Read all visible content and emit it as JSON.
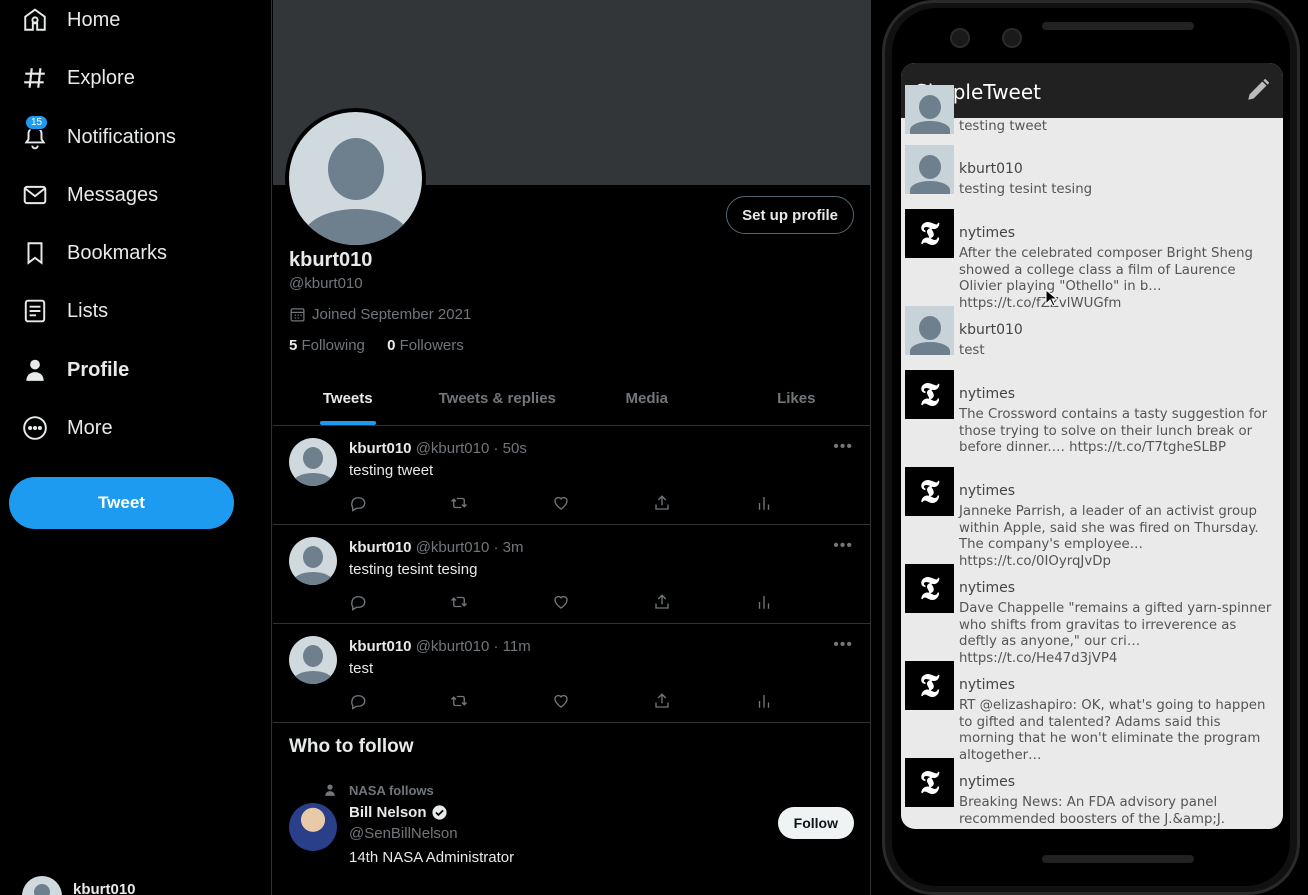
{
  "nav": {
    "items": [
      {
        "label": "Home",
        "icon": "home-icon"
      },
      {
        "label": "Explore",
        "icon": "hashtag-icon"
      },
      {
        "label": "Notifications",
        "icon": "bell-icon",
        "badge": "15"
      },
      {
        "label": "Messages",
        "icon": "envelope-icon"
      },
      {
        "label": "Bookmarks",
        "icon": "bookmark-icon"
      },
      {
        "label": "Lists",
        "icon": "list-icon"
      },
      {
        "label": "Profile",
        "icon": "person-icon"
      },
      {
        "label": "More",
        "icon": "more-circle-icon"
      }
    ],
    "tweet_button": "Tweet",
    "account_name": "kburt010"
  },
  "profile": {
    "setup_button": "Set up profile",
    "name": "kburt010",
    "handle": "@kburt010",
    "joined": "Joined September 2021",
    "following_count": "5",
    "following_label": "Following",
    "followers_count": "0",
    "followers_label": "Followers",
    "tabs": [
      "Tweets",
      "Tweets & replies",
      "Media",
      "Likes"
    ]
  },
  "tweets": [
    {
      "name": "kburt010",
      "meta": "@kburt010 · 50s",
      "text": "testing tweet"
    },
    {
      "name": "kburt010",
      "meta": "@kburt010 · 3m",
      "text": "testing tesint tesing"
    },
    {
      "name": "kburt010",
      "meta": "@kburt010 · 11m",
      "text": "test"
    }
  ],
  "who_to_follow": {
    "title": "Who to follow",
    "context": "NASA follows",
    "name": "Bill Nelson",
    "handle": "@SenBillNelson",
    "bio": "14th NASA Administrator",
    "follow_button": "Follow"
  },
  "phone": {
    "app_title": "SimpleTweet",
    "feed": [
      {
        "user": "",
        "text": "testing tweet",
        "kind": "user"
      },
      {
        "user": "kburt010",
        "text": "testing tesint tesing",
        "kind": "user"
      },
      {
        "user": "nytimes",
        "text": "After the celebrated composer Bright Sheng showed a college class a film of Laurence Olivier playing \"Othello\" in b… https://t.co/fZZvlWUGfm",
        "kind": "nyt"
      },
      {
        "user": "kburt010",
        "text": "test",
        "kind": "user"
      },
      {
        "user": "nytimes",
        "text": "The Crossword contains a tasty suggestion for those trying to solve on their lunch break or before dinner.… https://t.co/T7tgheSLBP",
        "kind": "nyt"
      },
      {
        "user": "nytimes",
        "text": "Janneke Parrish, a leader of an activist group within Apple, said she was fired on Thursday. The company's employee… https://t.co/0IOyrqJvDp",
        "kind": "nyt"
      },
      {
        "user": "nytimes",
        "text": "Dave Chappelle \"remains a gifted yarn-spinner who shifts from gravitas to irreverence as deftly as anyone,\" our cri… https://t.co/He47d3jVP4",
        "kind": "nyt"
      },
      {
        "user": "nytimes",
        "text": "RT @elizashapiro: OK, what's going to happen to gifted and talented? Adams said this morning that he won't eliminate the program altogether…",
        "kind": "nyt"
      },
      {
        "user": "nytimes",
        "text": "Breaking News: An FDA advisory panel recommended boosters of the J.&amp;J.",
        "kind": "nyt"
      }
    ]
  },
  "colors": {
    "accent": "#1d9bf0",
    "background": "#000000",
    "phone_screen": "#eaeaea",
    "appbar": "#212121"
  }
}
